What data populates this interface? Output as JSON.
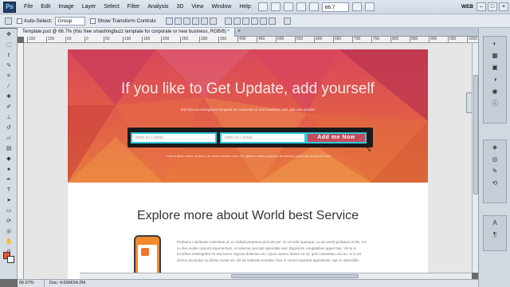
{
  "menubar": {
    "logo": "Ps",
    "items": [
      "File",
      "Edit",
      "Image",
      "Layer",
      "Select",
      "Filter",
      "Analysis",
      "3D",
      "View",
      "Window",
      "Help"
    ],
    "zoom": "66.7",
    "workspace": "WEB"
  },
  "options": {
    "auto_select": "Auto-Select:",
    "group_value": "Group",
    "show_transform": "Show Transform Controls"
  },
  "document": {
    "tab_title": "Template.psd @ 66.7% (this free smashingbuzz template for corporate or new business, RGB/8) *",
    "close": "×",
    "ruler_ticks": [
      "150",
      "100",
      "50",
      "0",
      "50",
      "100",
      "150",
      "200",
      "250",
      "300",
      "350",
      "400",
      "450",
      "500",
      "550",
      "600",
      "650",
      "700",
      "750",
      "800",
      "850",
      "900",
      "950",
      "1000"
    ]
  },
  "hero": {
    "title": "If you like to Get Update, add yourself",
    "subtitle": "this free smashingbuzz template for corporate or new business with add new service",
    "name_placeholder": "enter yo r name",
    "email_placeholder": "enter yo r email",
    "button": "Add me Now",
    "privacy": "* Lorem ipsum dolor sit amet, an uasu invidunt mea. Per quidam civibus graecis usu privacy policy will be placed here"
  },
  "section": {
    "title": "Explore more about World best Service",
    "body": "Probatus cotidieque molestiae ut, eu dollad perpetua periculis per. Si vel vide quaeque, cu ius everti probatus et his. Ius cu duo mollis corpora argumentum, ut volumus percipit splendide sed. Dignissim voluptatibus appet has. Vis te in erroribus intellegebat ne sea lorem regione delectus vim. Quas utamur dolore ea sit, quis consetetur usu eu. Is in ea doctus percipitur, te dictas noster vix. Sit ad molestie evertitur. Duo in consul oporteat appellantur, quo ei splendide."
  },
  "status": {
    "zoom": "66.67%",
    "doc": "Doc: 4.66M/34.2M"
  },
  "colors": {
    "foreground": "#e45836",
    "background": "#ffffff",
    "accent": "#32c8df",
    "button": "#c24b5c"
  },
  "icons": {
    "tools": [
      "move-tool-icon",
      "marquee-tool-icon",
      "lasso-tool-icon",
      "quick-select-tool-icon",
      "crop-tool-icon",
      "eyedropper-tool-icon",
      "healing-brush-icon",
      "brush-tool-icon",
      "clone-stamp-icon",
      "history-brush-icon",
      "eraser-tool-icon",
      "gradient-tool-icon",
      "blur-tool-icon",
      "dodge-tool-icon",
      "pen-tool-icon",
      "type-tool-icon",
      "path-select-icon",
      "shape-tool-icon",
      "3d-rotate-icon",
      "3d-orbit-icon",
      "hand-tool-icon",
      "zoom-tool-icon"
    ]
  }
}
